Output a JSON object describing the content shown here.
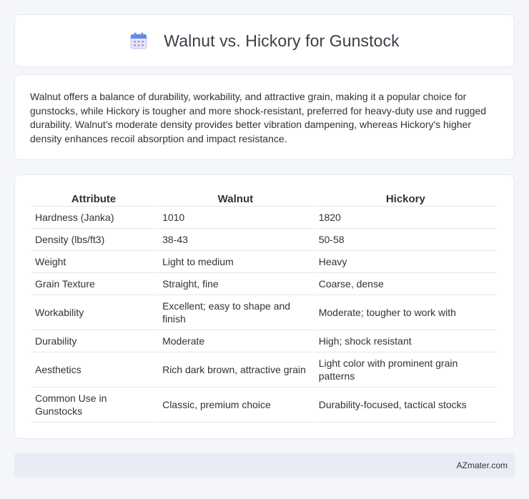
{
  "header": {
    "title": "Walnut vs. Hickory for Gunstock",
    "icon": "calendar-icon"
  },
  "summary": {
    "text": "Walnut offers a balance of durability, workability, and attractive grain, making it a popular choice for gunstocks, while Hickory is tougher and more shock-resistant, preferred for heavy-duty use and rugged durability. Walnut's moderate density provides better vibration dampening, whereas Hickory's higher density enhances recoil absorption and impact resistance."
  },
  "table": {
    "headers": [
      "Attribute",
      "Walnut",
      "Hickory"
    ],
    "rows": [
      [
        "Hardness (Janka)",
        "1010",
        "1820"
      ],
      [
        "Density (lbs/ft3)",
        "38-43",
        "50-58"
      ],
      [
        "Weight",
        "Light to medium",
        "Heavy"
      ],
      [
        "Grain Texture",
        "Straight, fine",
        "Coarse, dense"
      ],
      [
        "Workability",
        "Excellent; easy to shape and finish",
        "Moderate; tougher to work with"
      ],
      [
        "Durability",
        "Moderate",
        "High; shock resistant"
      ],
      [
        "Aesthetics",
        "Rich dark brown, attractive grain",
        "Light color with prominent grain patterns"
      ],
      [
        "Common Use in Gunstocks",
        "Classic, premium choice",
        "Durability-focused, tactical stocks"
      ]
    ]
  },
  "footer": {
    "text": "AZmater.com"
  },
  "colors": {
    "background": "#f4f6f9",
    "card": "#ffffff",
    "footer_bg": "#e8edf5",
    "icon_accent": "#5b8def"
  }
}
